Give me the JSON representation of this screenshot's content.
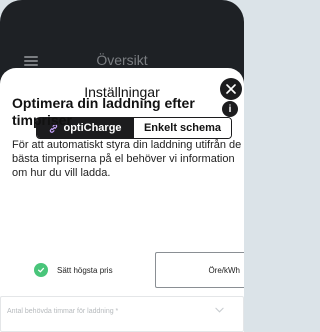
{
  "background_title": "Översikt",
  "modal": {
    "title": "Inställningar",
    "tabs": [
      {
        "label": "optiCharge",
        "active": true
      },
      {
        "label": "Enkelt schema",
        "active": false
      }
    ],
    "heading": "Optimera din laddning efter timpriser",
    "info_symbol": "i",
    "description": "För att automatiskt styra din laddning utifrån de bästa timpriserna på el behöver vi information om hur du vill ladda.",
    "max_price": {
      "checkbox_label": "Sätt högsta pris",
      "checked": true,
      "unit": "Öre/kWh"
    },
    "hours_field": {
      "placeholder": "Antal behövda timmar för laddning *"
    }
  },
  "colors": {
    "background": "#1e2125",
    "sheet": "#ffffff",
    "dark": "#1c1c1e",
    "check_green": "#49c57a"
  },
  "icons": {
    "menu": "hamburger-icon",
    "close": "close-icon",
    "link": "link-icon",
    "info": "info-icon",
    "check": "check-icon",
    "chevron": "chevron-down-icon"
  }
}
